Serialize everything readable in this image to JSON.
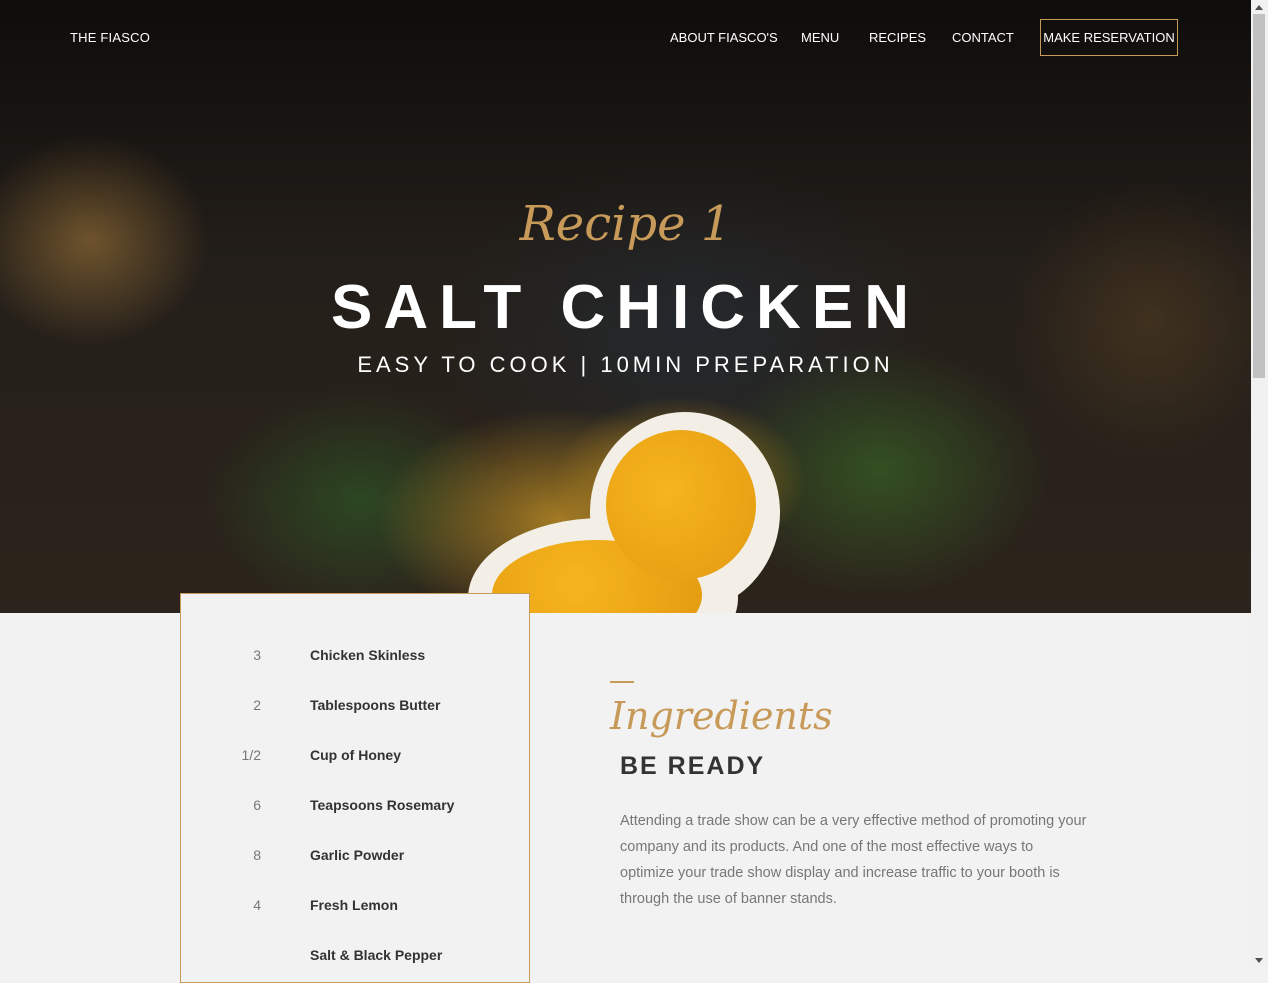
{
  "nav": {
    "brand": "THE FIASCO",
    "items": [
      "ABOUT FIASCO'S",
      "MENU",
      "RECIPES",
      "CONTACT"
    ],
    "reservation_label": "MAKE RESERVATION"
  },
  "hero": {
    "script": "Recipe 1",
    "title": "SALT CHICKEN",
    "subtitle": "EASY TO COOK | 10MIN PREPARATION"
  },
  "ingredients_list": [
    {
      "qty": "3",
      "name": "Chicken Skinless"
    },
    {
      "qty": "2",
      "name": "Tablespoons Butter"
    },
    {
      "qty": "1/2",
      "name": "Cup of Honey"
    },
    {
      "qty": "6",
      "name": "Teapsoons Rosemary"
    },
    {
      "qty": "8",
      "name": "Garlic Powder"
    },
    {
      "qty": "4",
      "name": "Fresh Lemon"
    },
    {
      "qty": "",
      "name": "Salt & Black Pepper"
    }
  ],
  "section": {
    "script": "Ingredients",
    "title": "BE READY",
    "body": "Attending a trade show can be a very effective method of promoting your company and its products. And one of the most effective ways to optimize your trade show display and increase traffic to your booth is through the use of banner stands."
  },
  "colors": {
    "accent": "#c89a5a",
    "background": "#f2f2f2"
  }
}
